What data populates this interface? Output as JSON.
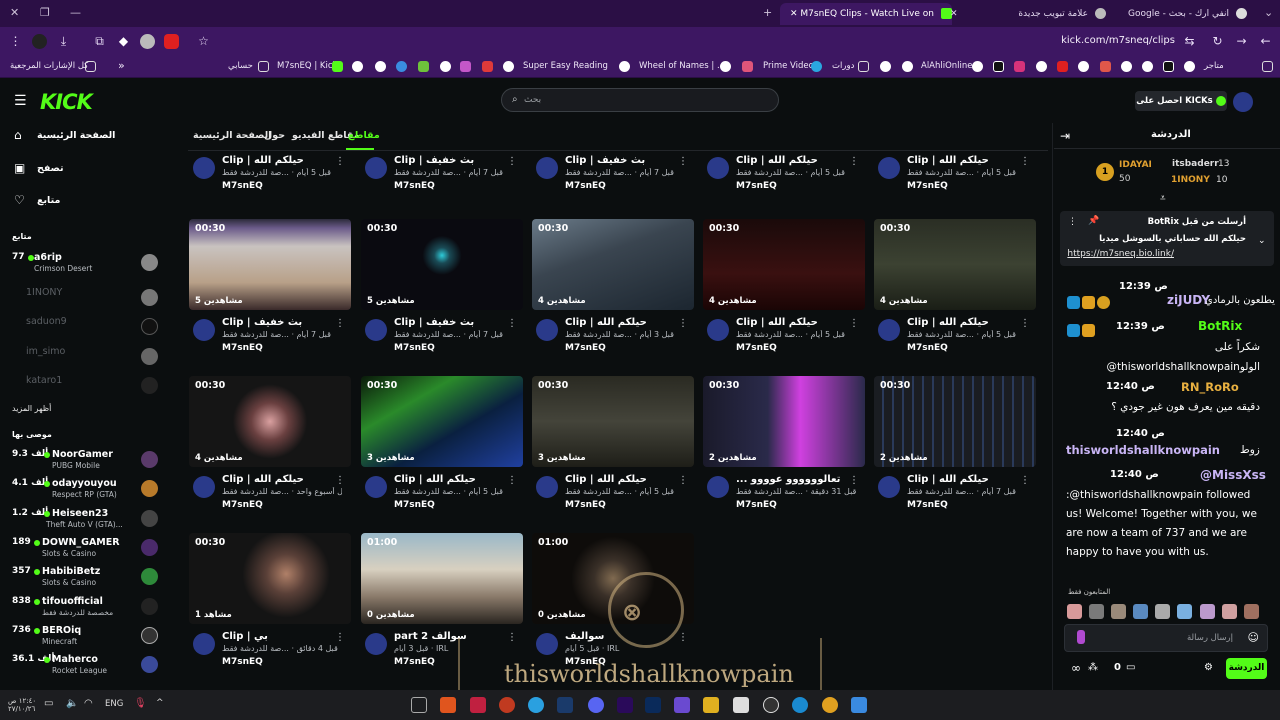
{
  "browser": {
    "tabs": [
      {
        "label": "Google - انفي ارك - بحث",
        "active": false
      },
      {
        "label": "علامة تبويب جديدة",
        "active": false
      },
      {
        "label": "M7snEQ Clips - Watch Live on",
        "active": true
      }
    ],
    "url": "kick.com/m7sneq/clips"
  },
  "bookmarks": [
    "كل الإشارات المرجعية",
    "حسابي",
    "M7snEQ | Kick",
    "Super Easy Reading",
    "Wheel of Names | ...",
    "Prime Video",
    "دورات",
    "AlAhliOnline",
    "متاجر"
  ],
  "header": {
    "logo": "KICK",
    "search_placeholder": "بحث",
    "get_kicks": "احصل على KICKs"
  },
  "sidebar": {
    "nav": [
      "الصفحة الرئيسية",
      "تصفح",
      "متابع"
    ],
    "following_title": "متابع",
    "following": [
      {
        "name": "a6rip",
        "sub": "Crimson Desert",
        "count": "77",
        "live": true
      },
      {
        "name": "1INONY",
        "sub": "",
        "count": "",
        "live": false
      },
      {
        "name": "saduon9",
        "sub": "",
        "count": "",
        "live": false
      },
      {
        "name": "im_simo",
        "sub": "",
        "count": "",
        "live": false
      },
      {
        "name": "kataro1",
        "sub": "",
        "count": "",
        "live": false
      }
    ],
    "show_more": "أظهر المزيد",
    "recommended_title": "موصى بها",
    "recommended": [
      {
        "name": "NoorGamer",
        "sub": "PUBG Mobile",
        "count": "9.3 ألف"
      },
      {
        "name": "odayyouyou",
        "sub": "Respect RP (GTA)",
        "count": "4.1 ألف"
      },
      {
        "name": "Heiseen23",
        "sub": "Theft Auto V (GTA)...",
        "count": "1.2 ألف"
      },
      {
        "name": "DOWN_GAMER",
        "sub": "Slots & Casino",
        "count": "189"
      },
      {
        "name": "HabibiBetz",
        "sub": "Slots & Casino",
        "count": "357"
      },
      {
        "name": "tifouofficial",
        "sub": "مخصصة للدردشة فقط",
        "count": "838"
      },
      {
        "name": "BEROiq",
        "sub": "Minecraft",
        "count": "736"
      },
      {
        "name": "Maherco",
        "sub": "Rocket League",
        "count": "36.1 ألف"
      }
    ]
  },
  "profile_tabs": [
    "الصفحة الرئيسية",
    "حول",
    "مقاطع الفيديو",
    "مقاطع"
  ],
  "clips_top": [
    {
      "title": "Clip | حيلكم الله",
      "meta": "قبل 5 أيام · ...صة للدردشة فقط",
      "channel": "M7snEQ"
    },
    {
      "title": "Clip | بث خفيف",
      "meta": "قبل 7 أيام · ...صة للدردشة فقط",
      "channel": "M7snEQ"
    },
    {
      "title": "Clip | بث خفيف",
      "meta": "قبل 7 أيام · ...صة للدردشة فقط",
      "channel": "M7snEQ"
    },
    {
      "title": "Clip | حيلكم الله",
      "meta": "قبل 5 أيام · ...صة للدردشة فقط",
      "channel": "M7snEQ"
    },
    {
      "title": "Clip | حيلكم الله",
      "meta": "قبل 5 أيام · ...صة للدردشة فقط",
      "channel": "M7snEQ"
    }
  ],
  "clips_row1": [
    {
      "dur": "00:30",
      "views": "5 مشاهدين",
      "title": "Clip | بث خفيف",
      "meta": "قبل 7 أيام · ...صة للدردشة فقط",
      "channel": "M7snEQ"
    },
    {
      "dur": "00:30",
      "views": "5 مشاهدين",
      "title": "Clip | بث خفيف",
      "meta": "قبل 7 أيام · ...صة للدردشة فقط",
      "channel": "M7snEQ"
    },
    {
      "dur": "00:30",
      "views": "4 مشاهدين",
      "title": "Clip | حيلكم الله",
      "meta": "قبل 3 أيام · ...صة للدردشة فقط",
      "channel": "M7snEQ"
    },
    {
      "dur": "00:30",
      "views": "4 مشاهدين",
      "title": "Clip | حيلكم الله",
      "meta": "قبل 5 أيام · ...صة للدردشة فقط",
      "channel": "M7snEQ"
    },
    {
      "dur": "00:30",
      "views": "4 مشاهدين",
      "title": "Clip | حيلكم الله",
      "meta": "قبل 5 أيام · ...صة للدردشة فقط",
      "channel": "M7snEQ"
    }
  ],
  "clips_row2": [
    {
      "dur": "00:30",
      "views": "4 مشاهدين",
      "title": "Clip | حيلكم الله",
      "meta": "قبل أسبوع واحد · ...صة للدردشة فقط",
      "channel": "M7snEQ"
    },
    {
      "dur": "00:30",
      "views": "3 مشاهدين",
      "title": "Clip | حيلكم الله",
      "meta": "قبل 5 أيام · ...صة للدردشة فقط",
      "channel": "M7snEQ"
    },
    {
      "dur": "00:30",
      "views": "3 مشاهدين",
      "title": "Clip | حيلكم الله",
      "meta": "قبل 5 أيام · ...صة للدردشة فقط",
      "channel": "M7snEQ"
    },
    {
      "dur": "00:30",
      "views": "2 مشاهدين",
      "title": "... تعالوووووو عوووو",
      "meta": "قبل 31 دقيقة · ...صة للدردشة فقط",
      "channel": "M7snEQ"
    },
    {
      "dur": "00:30",
      "views": "2 مشاهدين",
      "title": "Clip | حيلكم الله",
      "meta": "قبل 7 أيام · ...صة للدردشة فقط",
      "channel": "M7snEQ"
    }
  ],
  "clips_row3": [
    {
      "dur": "00:30",
      "views": "1 مشاهد",
      "title": "Clip | بي",
      "meta": "قبل 4 دقائق · ...صة للدردشة فقط",
      "channel": "M7snEQ"
    },
    {
      "dur": "01:00",
      "views": "0 مشاهدين",
      "title": "part 2 سوالف",
      "meta": "قبل 3 أيام · IRL",
      "channel": "M7snEQ"
    },
    {
      "dur": "01:00",
      "views": "0 مشاهدين",
      "title": "سواليف",
      "meta": "قبل 5 أيام · IRL",
      "channel": "M7snEQ"
    }
  ],
  "chat": {
    "title": "الدردشة",
    "leaderboard": [
      {
        "name": "itsbaderr",
        "count": "13"
      },
      {
        "name": "1INONY",
        "count": "10"
      },
      {
        "name": "IDAYAI",
        "count": "50"
      }
    ],
    "pinned": {
      "header": "BotRix أرسلت من قبل",
      "text": "حيلكم الله حساباتي بالسوشل ميديا",
      "link": "https://m7sneq.bio.link/"
    },
    "messages": [
      {
        "time": "12:39 ص",
        "user": "ziJUDY",
        "text": "يطلعون بالرمادي"
      },
      {
        "time": "12:39 ص",
        "user": "BotRix",
        "text": "شكراً على @thisworldshallknowpainالولو"
      },
      {
        "time": "12:40 ص",
        "user": "RN_RoRo",
        "text": "دقيقه مين يعرف هون غير جودي ؟"
      },
      {
        "time": "12:40 ص",
        "user": "thisworldshallknowpain",
        "text": "زوط"
      },
      {
        "time": "12:40 ص",
        "user": "@MissXss",
        "text": ":@thisworldshallknowpain followed us! Welcome! Together with you, we are now a team of 737 and we are happy to have you with us."
      }
    ],
    "subs_only": "المتابعون فقط",
    "input_placeholder": "إرسال رسالة",
    "send_label": "الدردشة",
    "points": "0"
  },
  "watermark": "thisworldshallknowpain",
  "taskbar": {
    "lang": "ENG",
    "time": "١٢:٤٠ ص",
    "date": "٢٧/١٠/٢٦"
  },
  "colors": {
    "accent": "#53fc18",
    "browser": "#3d1762",
    "bg": "#0b0e0f"
  }
}
